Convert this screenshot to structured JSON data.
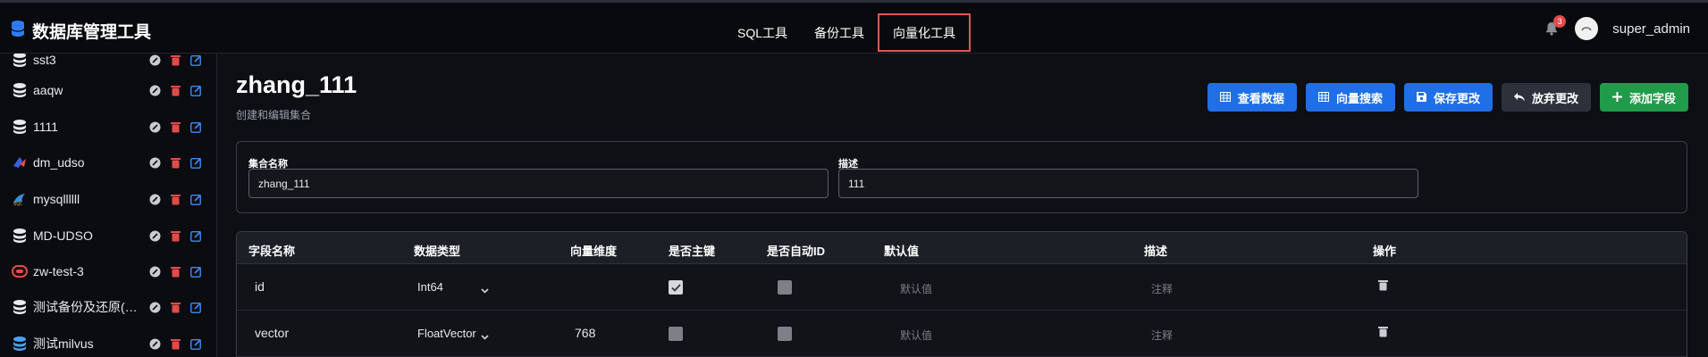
{
  "brand": {
    "title": "数据库管理工具",
    "icon": "database-icon"
  },
  "nav": {
    "items": [
      {
        "label": "SQL工具",
        "active": false
      },
      {
        "label": "备份工具",
        "active": false
      },
      {
        "label": "向量化工具",
        "active": true
      }
    ]
  },
  "user": {
    "notification_count": "3",
    "name": "super_admin"
  },
  "sidebar": {
    "items": [
      {
        "name": "sst3",
        "icon": "database-icon"
      },
      {
        "name": "aaqw",
        "icon": "database-icon"
      },
      {
        "name": "1111",
        "icon": "database-icon"
      },
      {
        "name": "dm_udso",
        "icon": "dameng-db-icon"
      },
      {
        "name": "mysqllllll",
        "icon": "mysql-icon"
      },
      {
        "name": "MD-UDSO",
        "icon": "database-icon"
      },
      {
        "name": "zw-test-3",
        "icon": "oracle-icon"
      },
      {
        "name": "测试备份及还原(…",
        "icon": "database-icon"
      },
      {
        "name": "测试milvus",
        "icon": "milvus-icon"
      }
    ]
  },
  "page": {
    "title": "zhang_111",
    "subtitle": "创建和编辑集合"
  },
  "buttons": {
    "view_data": "查看数据",
    "vector_search": "向量搜索",
    "save": "保存更改",
    "discard": "放弃更改",
    "add_field": "添加字段"
  },
  "form": {
    "name_label": "集合名称",
    "name_value": "zhang_111",
    "desc_label": "描述",
    "desc_value": "111"
  },
  "table": {
    "headers": [
      "字段名称",
      "数据类型",
      "向量维度",
      "是否主键",
      "是否自动ID",
      "默认值",
      "描述",
      "操作"
    ],
    "rows": [
      {
        "name": "id",
        "type": "Int64",
        "dim": "",
        "primary": true,
        "auto_id": false,
        "default_ph": "默认值",
        "desc_ph": "注释"
      },
      {
        "name": "vector",
        "type": "FloatVector",
        "dim": "768",
        "primary": false,
        "auto_id": false,
        "default_ph": "默认值",
        "desc_ph": "注释"
      }
    ]
  },
  "colors": {
    "accent": "#1f6fe6",
    "success": "#1f9b4a",
    "danger": "#e24a4a",
    "active_nav_border": "#e05555"
  }
}
